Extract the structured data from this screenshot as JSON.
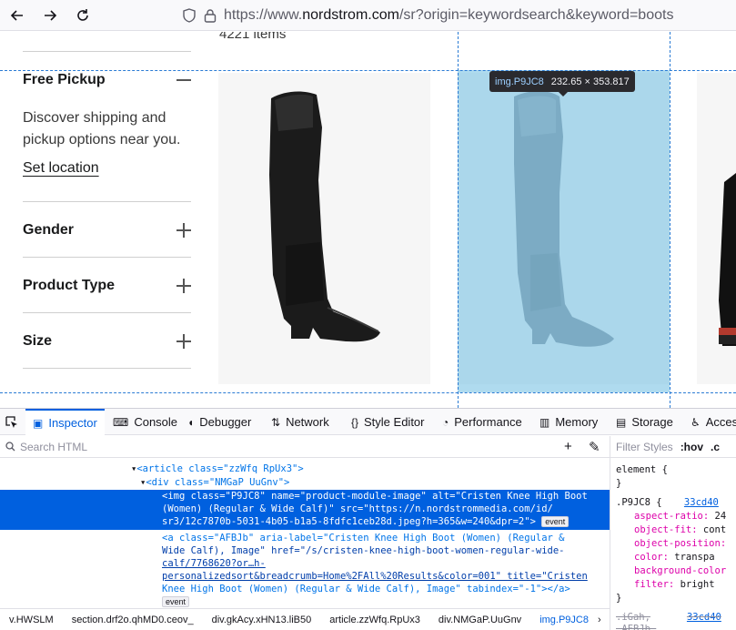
{
  "browser": {
    "url_prefix": "https://www.",
    "url_domain": "nordstrom.com",
    "url_path": "/sr?origin=keywordsearch&keyword=boots"
  },
  "page": {
    "items_count": "4221 items",
    "filters": {
      "free_pickup": {
        "title": "Free Pickup",
        "description": "Discover shipping and pickup options near you.",
        "set_location": "Set location"
      },
      "gender": "Gender",
      "product_type": "Product Type",
      "size": "Size"
    }
  },
  "inspector_overlay": {
    "selector": "img.P9JC8",
    "dimensions": "232.65 × 353.817"
  },
  "devtools": {
    "tabs": [
      "Inspector",
      "Console",
      "Debugger",
      "Network",
      "Style Editor",
      "Performance",
      "Memory",
      "Storage",
      "Accessibility"
    ],
    "search_placeholder": "Search HTML",
    "tree": {
      "article_open": "<article class=\"zzWfq RpUx3\">",
      "div_open": "<div class=\"NMGaP UuGnv\">",
      "img_l1": "<img class=\"P9JC8\" name=\"product-module-image\" alt=\"Cristen Knee High Boot",
      "img_l2": "(Women) (Regular & Wide Calf)\" src=\"https://n.nordstrommedia.com/id/",
      "img_l3": "sr3/12c7870b-5031-4b05-b1a5-8fdfc1ceb28d.jpeg?h=365&w=240&dpr=2\">",
      "a_l1": "<a class=\"AFBJb\" aria-label=\"Cristen Knee High Boot (Women) (Regular &",
      "a_l2": "Wide Calf), Image\" href=\"/s/cristen-knee-high-boot-women-regular-wide-",
      "a_l3": "calf/7768620?or…h-",
      "a_l4": "personalizedsort&breadcrumb=Home%2FAll%20Results&color=001\" title=\"Cristen",
      "a_l5": "Knee High Boot (Women) (Regular & Wide Calf), Image\" tabindex=\"-1\"></a>",
      "event_badge": "event"
    },
    "breadcrumbs": [
      "v.HWSLM",
      "section.drf2o.qhMD0.ceov_",
      "div.gkAcy.xHN13.liB50",
      "article.zzWfq.RpUx3",
      "div.NMGaP.UuGnv",
      "img.P9JC8"
    ],
    "rules": {
      "filter_placeholder": "Filter Styles",
      "hov": ":hov",
      "cls": ".c",
      "element": "element",
      "brace_open": "{",
      "brace_close": "}",
      "selector": ".P9JC8",
      "source": "33cd40",
      "props": [
        {
          "name": "aspect-ratio:",
          "value": "24"
        },
        {
          "name": "object-fit:",
          "value": "cont"
        },
        {
          "name": "object-position:",
          "value": ""
        },
        {
          "name": "color:",
          "value": "transpa"
        },
        {
          "name": "background-color",
          "value": ""
        },
        {
          "name": "filter:",
          "value": "bright"
        }
      ],
      "next_selector_1": ".iGah,",
      "next_selector_2": ".AFBJb,",
      "next_source": "33cd40"
    }
  }
}
